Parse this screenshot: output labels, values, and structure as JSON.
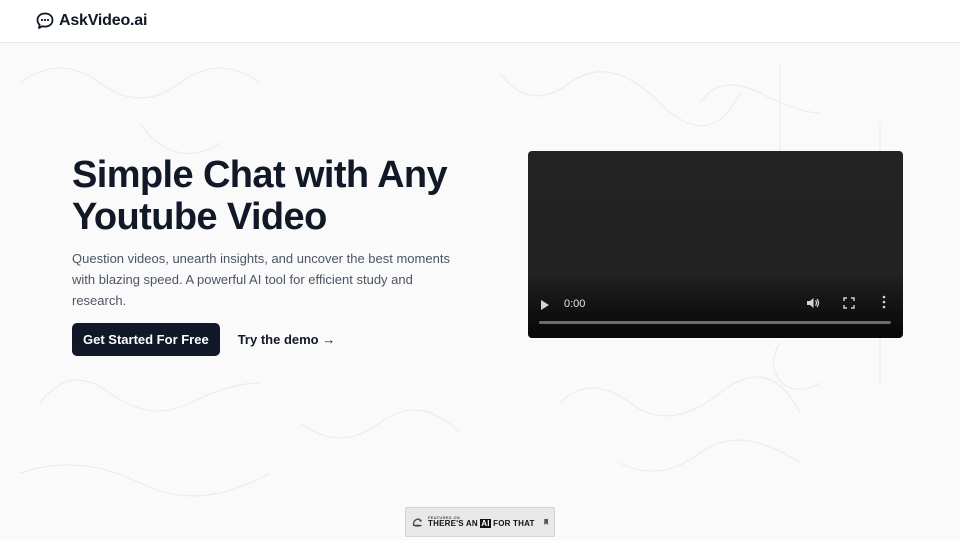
{
  "header": {
    "brand_name": "AskVideo.ai"
  },
  "hero": {
    "headline": "Simple Chat with Any Youtube Video",
    "subtext": "Question videos, unearth insights, and uncover the best moments with blazing speed. A powerful AI tool for efficient study and research.",
    "primary_cta": "Get Started For Free",
    "secondary_cta": "Try the demo →"
  },
  "video_player": {
    "time": "0:00",
    "progress": 0,
    "icons": [
      "play-icon",
      "volume-icon",
      "fullscreen-icon",
      "more-options-icon"
    ]
  },
  "badge": {
    "featured_label": "FEATURED ON",
    "main_prefix": "THERE'S AN ",
    "main_ai": "AI",
    "main_suffix": " FOR THAT"
  },
  "colors": {
    "primary_button": "#111827",
    "background": "#fafafa",
    "video_bg": "#222222"
  }
}
